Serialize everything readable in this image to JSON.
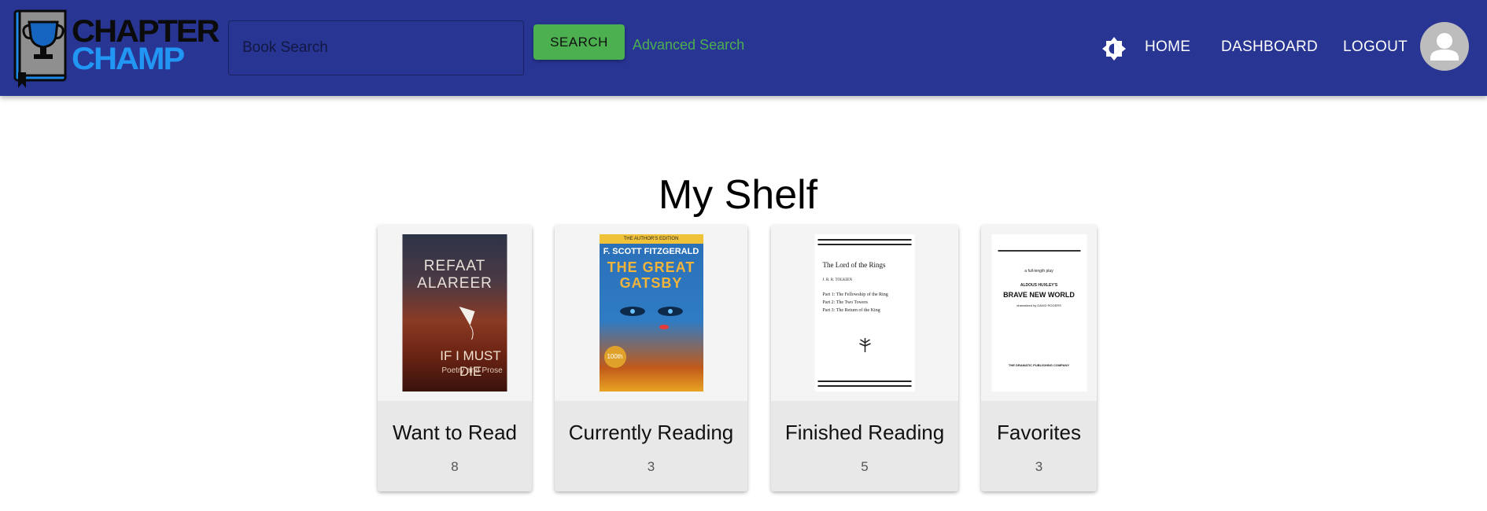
{
  "brand": {
    "line1": "CHAPTER",
    "line2": "CHAMP"
  },
  "search": {
    "placeholder": "Book Search",
    "value": "",
    "button_label": "SEARCH",
    "advanced_label": "Advanced Search"
  },
  "nav": {
    "home": "HOME",
    "dashboard": "DASHBOARD",
    "logout": "LOGOUT"
  },
  "page_title": "My Shelf",
  "shelves": [
    {
      "label": "Want to Read",
      "count": "8",
      "cover": {
        "author": "REFAAT ALAREER",
        "title": "IF I MUST DIE",
        "subtitle": "Poetry and Prose"
      }
    },
    {
      "label": "Currently Reading",
      "count": "3",
      "cover": {
        "banner": "THE AUTHOR'S EDITION",
        "author": "F. SCOTT FITZGERALD",
        "title_line1": "THE GREAT",
        "title_line2": "GATSBY",
        "badge": "100th"
      }
    },
    {
      "label": "Finished Reading",
      "count": "5",
      "cover": {
        "title": "The Lord of the Rings",
        "author": "J. R. R. TOLKIEN",
        "part1": "Part 1: The Fellowship of the Ring",
        "part2": "Part 2: The Two Towers",
        "part3": "Part 3: The Return of the King"
      }
    },
    {
      "label": "Favorites",
      "count": "3",
      "cover": {
        "kicker": "a full-length play",
        "author": "ALDOUS HUXLEY'S",
        "title": "BRAVE NEW WORLD",
        "credit": "dramatized by DAVID ROGERS",
        "publisher": "THE DRAMATIC PUBLISHING COMPANY"
      }
    }
  ],
  "colors": {
    "header": "#283593",
    "search_button": "#4caf50",
    "link": "#4caf50",
    "brand_accent": "#2196f3"
  }
}
